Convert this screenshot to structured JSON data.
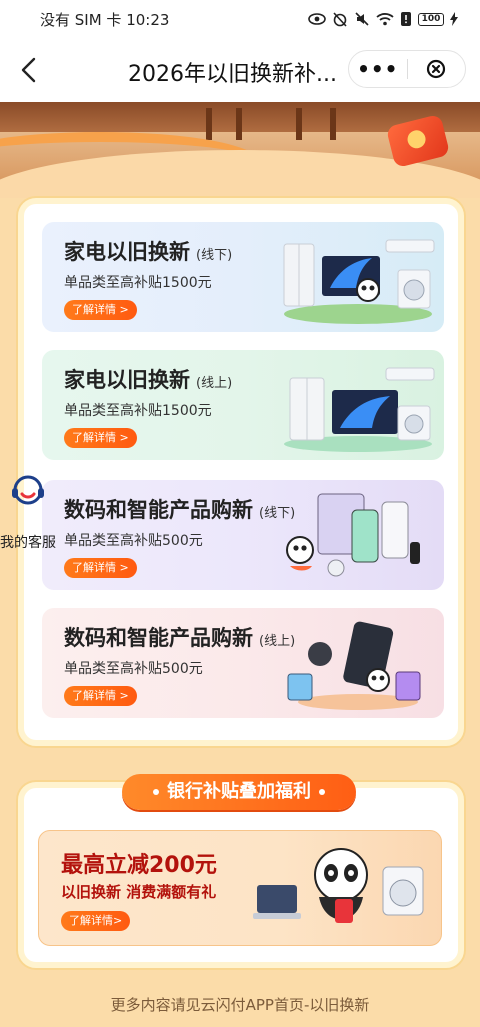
{
  "status_bar": {
    "left_text": "没有 SIM 卡 10:23",
    "battery": "100"
  },
  "nav": {
    "title": "2026年以旧换新补...",
    "more_label": "•••"
  },
  "cards": [
    {
      "title": "家电以旧换新",
      "tag": "(线下)",
      "subtitle": "单品类至高补贴1500元",
      "button": "了解详情 >"
    },
    {
      "title": "家电以旧换新",
      "tag": "(线上)",
      "subtitle": "单品类至高补贴1500元",
      "button": "了解详情 >"
    },
    {
      "title": "数码和智能产品购新",
      "tag": "(线下)",
      "subtitle": "单品类至高补贴500元",
      "button": "了解详情 >"
    },
    {
      "title": "数码和智能产品购新",
      "tag": "(线上)",
      "subtitle": "单品类至高补贴500元",
      "button": "了解详情 >"
    }
  ],
  "customer_service": {
    "label": "我的客服"
  },
  "bank": {
    "section_title": "银行补贴叠加福利",
    "headline": "最高立减200元",
    "subline": "以旧换新  消费满额有礼",
    "button": "了解详情>"
  },
  "footer": {
    "text": "更多内容请见云闪付APP首页-以旧换新"
  },
  "colors": {
    "accent": "#ff6a1a",
    "page_bg": "#fbdca9",
    "bank_red": "#b3120c"
  }
}
